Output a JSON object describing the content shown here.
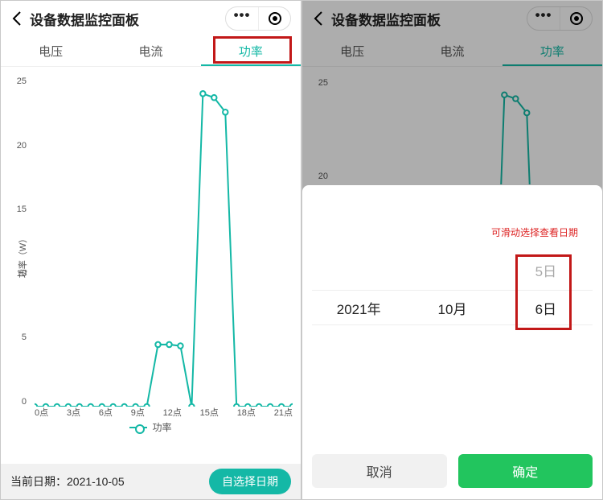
{
  "colors": {
    "accent": "#14b8a6",
    "danger": "#c21818",
    "confirm": "#22c55e"
  },
  "header": {
    "title": "设备数据监控面板"
  },
  "tabs": {
    "items": [
      "电压",
      "电流",
      "功率"
    ],
    "active_index": 2
  },
  "chart_data": {
    "type": "line",
    "title": "",
    "xlabel": "",
    "ylabel": "功率（W）",
    "ylim": [
      0,
      25
    ],
    "x_tick_labels": [
      "0点",
      "3点",
      "6点",
      "9点",
      "12点",
      "15点",
      "18点",
      "21点"
    ],
    "y_ticks": [
      0,
      5,
      10,
      15,
      20,
      25
    ],
    "series": [
      {
        "name": "功率",
        "x": [
          0,
          1,
          2,
          3,
          4,
          5,
          6,
          7,
          8,
          9,
          10,
          11,
          12,
          13,
          14,
          15,
          16,
          17,
          18,
          19,
          20,
          21,
          22,
          23
        ],
        "values": [
          0,
          0,
          0,
          0,
          0,
          0,
          0,
          0,
          0,
          0,
          0,
          4.7,
          4.7,
          4.6,
          0,
          23.7,
          23.4,
          22.3,
          0,
          0,
          0,
          0,
          0,
          0
        ]
      }
    ],
    "legend": "功率"
  },
  "footer": {
    "date_label": "当前日期：",
    "date_value": "2021-10-05",
    "button_label": "自选择日期"
  },
  "picker": {
    "hint": "可滑动选择查看日期",
    "year": "2021年",
    "month": "10月",
    "day": "6日",
    "day_prev": "5日",
    "cancel": "取消",
    "confirm": "确定"
  }
}
